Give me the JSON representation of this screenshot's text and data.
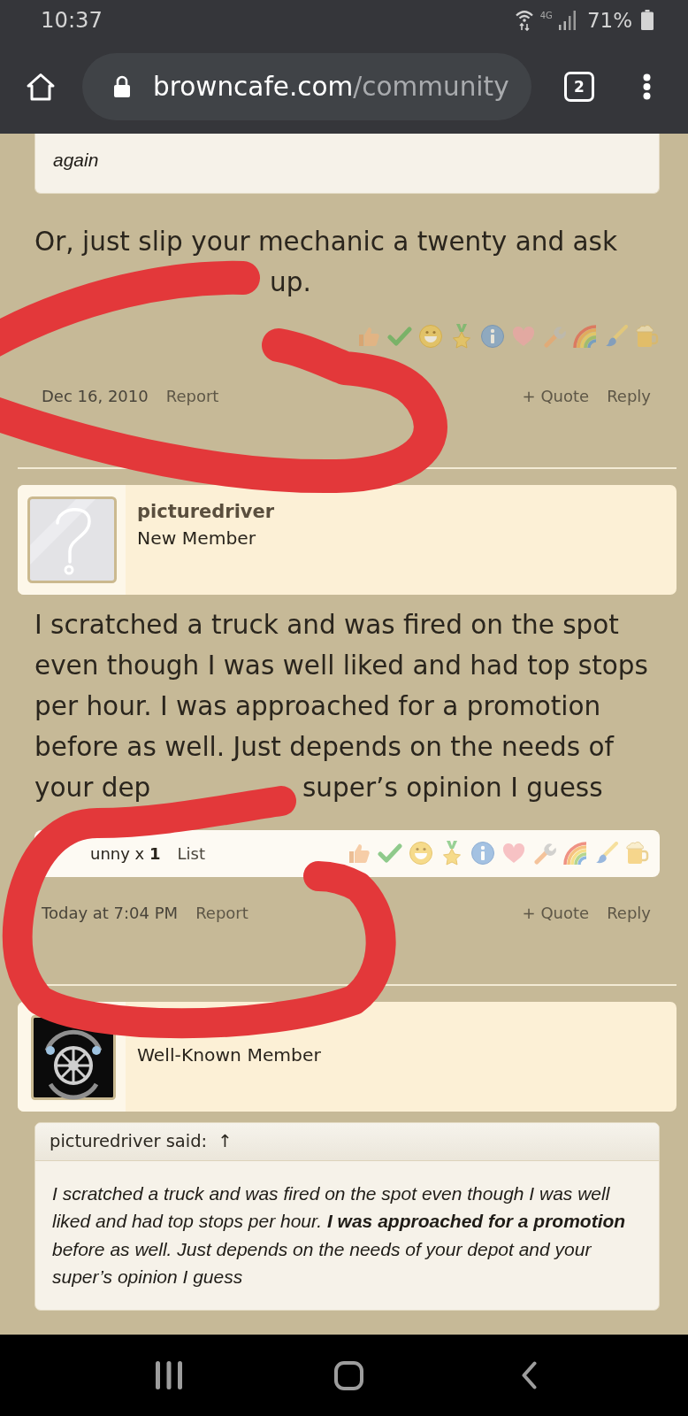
{
  "status_bar": {
    "time": "10:37",
    "network": "4G",
    "battery": "71%"
  },
  "browser": {
    "domain": "browncafe.com",
    "path": "/community",
    "tab_count": "2"
  },
  "posts": [
    {
      "quote": {
        "text": "again"
      },
      "body": "Or, just slip your mechanic a twenty and ask",
      "covered_line": {
        "end": "up."
      },
      "date": "Dec 16, 2010",
      "report": "Report",
      "quote_link": "+ Quote",
      "reply": "Reply"
    },
    {
      "author": {
        "name": "picturedriver",
        "role": "New Member",
        "avatar": {
          "kind": "placeholder"
        }
      },
      "body": "I scratched a truck and was fired on the spot even though I was well liked and had top stops per hour. I was approached for a promotion before as well. Just depends on the needs of",
      "covered_line": {
        "start": "your dep",
        "end": "super’s opinion I guess"
      },
      "reaction_summary": {
        "text": "unny x **1**",
        "list": "List"
      },
      "date": "Today at 7:04 PM",
      "report": "Report",
      "quote_link": "+ Quote",
      "reply": "Reply"
    },
    {
      "author": {
        "role": "Well-Known Member",
        "avatar": {
          "kind": "logo"
        }
      },
      "quote": {
        "attribution": "picturedriver said:",
        "jump": "↑",
        "text": "I scratched a truck and was fired on the spot even though I was well liked and had top stops per hour. **I was approached for a promotion** before as well. Just depends on the needs of your depot and your super’s opinion I guess"
      }
    }
  ]
}
